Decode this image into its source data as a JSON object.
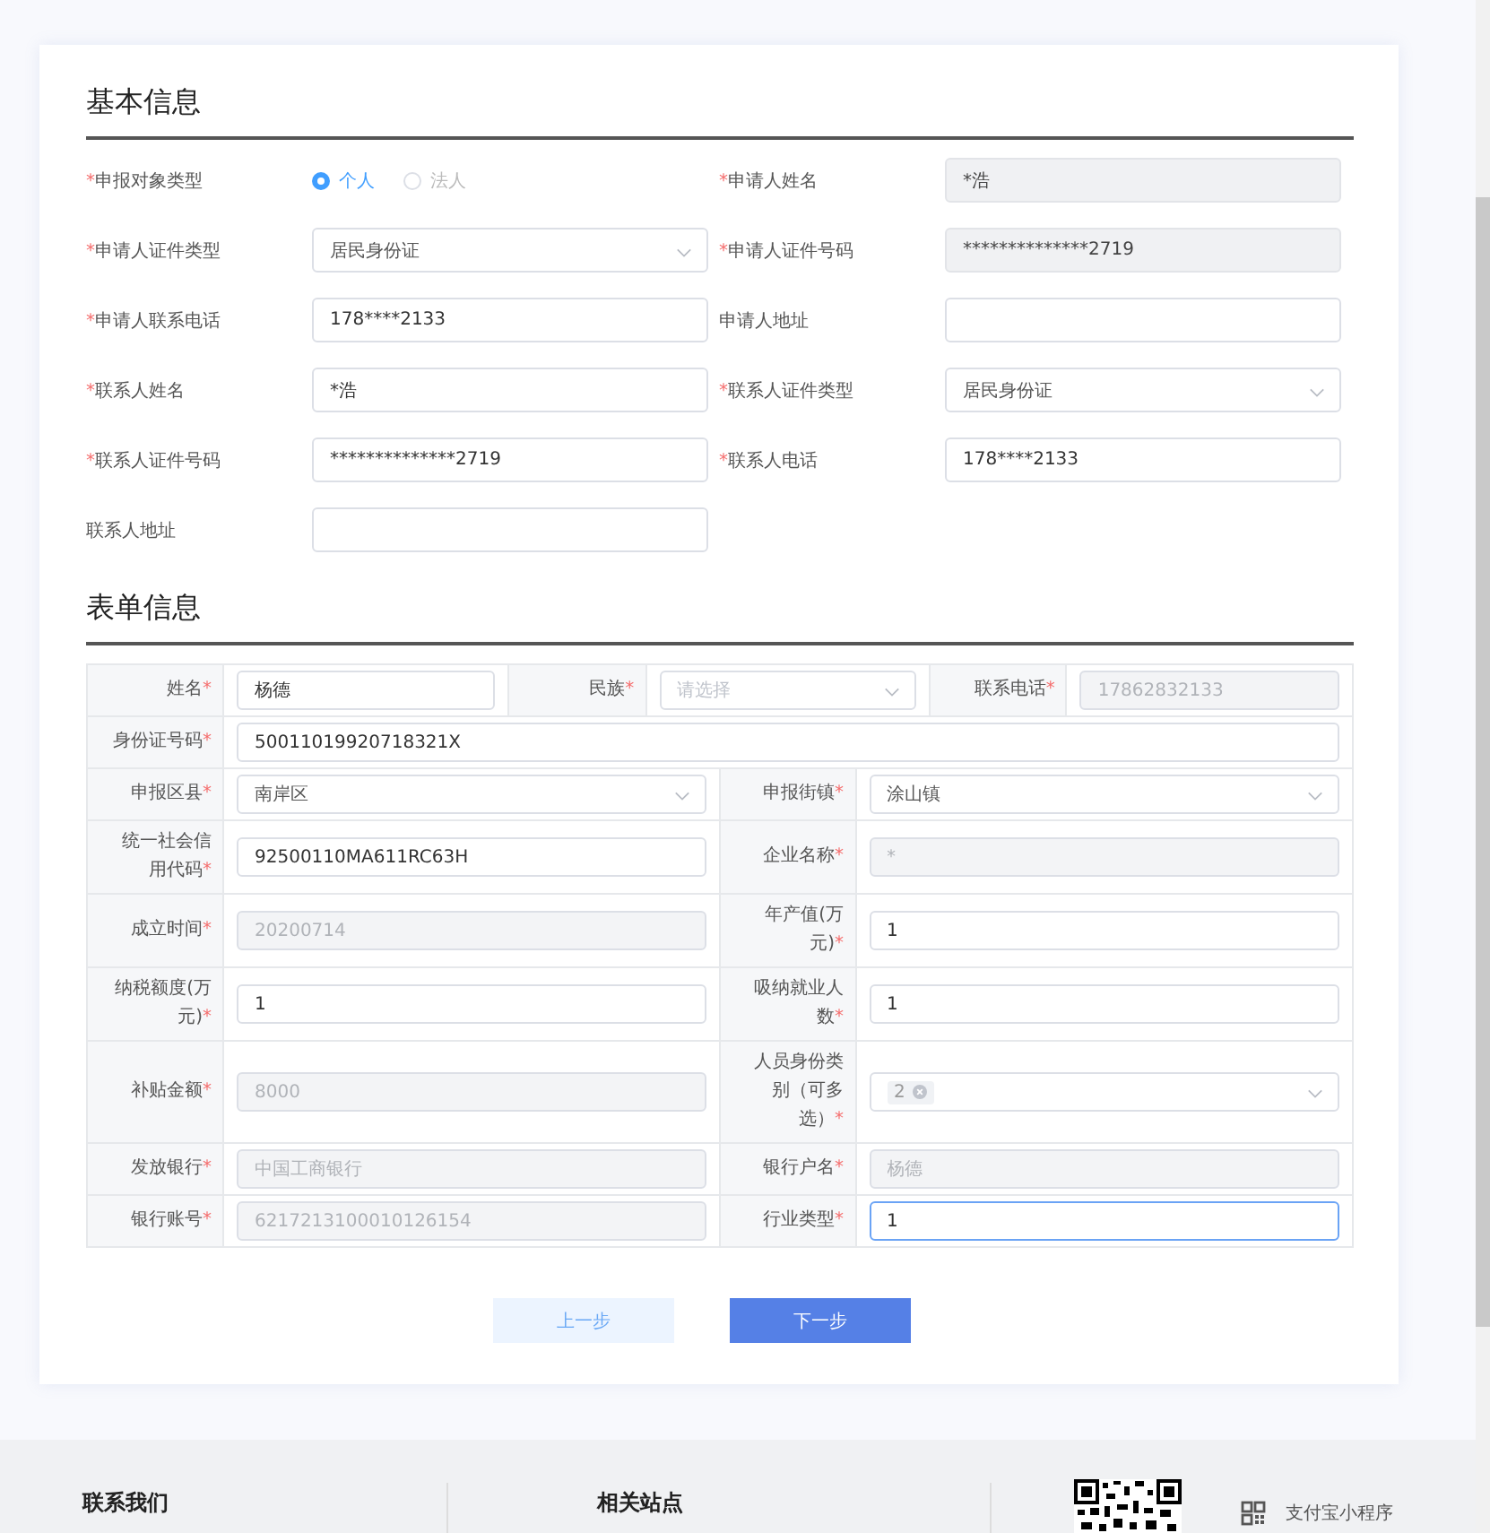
{
  "basic_info": {
    "title": "基本信息",
    "fields": [
      {
        "mark": "*",
        "label": "申报对象类型",
        "kind": "radio",
        "options": [
          {
            "label": "个人",
            "selected": true
          },
          {
            "label": "法人",
            "selected": false
          }
        ]
      },
      {
        "mark": "*",
        "label": "申请人姓名",
        "kind": "text",
        "value": "*浩",
        "disabled": true
      },
      {
        "mark": "*",
        "label": "申请人证件类型",
        "kind": "select",
        "value": "居民身份证",
        "disabled": false
      },
      {
        "mark": "*",
        "label": "申请人证件号码",
        "kind": "text",
        "value": "**************2719",
        "disabled": true
      },
      {
        "mark": "*",
        "label": "申请人联系电话",
        "kind": "text",
        "value": "178****2133",
        "disabled": false
      },
      {
        "label": "申请人地址",
        "kind": "text",
        "disabled": false
      },
      {
        "mark": "*",
        "label": "联系人姓名",
        "kind": "text",
        "value": "*浩",
        "disabled": false
      },
      {
        "mark": "*",
        "label": "联系人证件类型",
        "kind": "select",
        "value": "居民身份证",
        "disabled": false
      },
      {
        "mark": "*",
        "label": "联系人证件号码",
        "kind": "text",
        "value": "**************2719",
        "disabled": false
      },
      {
        "mark": "*",
        "label": "联系人电话",
        "kind": "text",
        "value": "178****2133",
        "disabled": false
      },
      {
        "label": "联系人地址",
        "kind": "text",
        "disabled": false
      }
    ]
  },
  "form_info": {
    "title": "表单信息",
    "rows": [
      {
        "cells": [
          {
            "label": "姓名",
            "mark": "*",
            "kind": "text",
            "value": "杨德",
            "disabled": false
          },
          {
            "label": "民族",
            "mark": "*",
            "kind": "select",
            "placeholder": "请选择",
            "disabled": false
          },
          {
            "label": "联系电话",
            "mark": "*",
            "kind": "text",
            "value": "17862832133",
            "disabled": true
          }
        ]
      },
      {
        "cells": [
          {
            "label": "身份证号码",
            "mark": "*",
            "kind": "text",
            "value": "50011019920718321X",
            "disabled": false
          }
        ]
      },
      {
        "cells": [
          {
            "label": "申报区县",
            "mark": "*",
            "kind": "select",
            "value": "南岸区",
            "disabled": false
          },
          {
            "label": "申报街镇",
            "mark": "*",
            "kind": "select",
            "value": "涂山镇",
            "disabled": false
          }
        ]
      },
      {
        "cells": [
          {
            "label": "统一社会信用代码",
            "mark": "*",
            "kind": "text",
            "value": "92500110MA611RC63H",
            "disabled": false
          },
          {
            "label": "企业名称",
            "mark": "*",
            "kind": "text",
            "value": "*",
            "disabled": true
          }
        ]
      },
      {
        "cells": [
          {
            "label": "成立时间",
            "mark": "*",
            "kind": "text",
            "value": "20200714",
            "disabled": true
          },
          {
            "label": "年产值(万元)",
            "mark": "*",
            "kind": "text",
            "value": "1",
            "disabled": false
          }
        ]
      },
      {
        "cells": [
          {
            "label": "纳税额度(万元)",
            "mark": "*",
            "kind": "text",
            "value": "1",
            "disabled": false
          },
          {
            "label": "吸纳就业人数",
            "mark": "*",
            "kind": "text",
            "value": "1",
            "disabled": false
          }
        ]
      },
      {
        "cells": [
          {
            "label": "补贴金额",
            "mark": "*",
            "kind": "text",
            "value": "8000",
            "disabled": true
          },
          {
            "label": "人员身份类别（可多选）",
            "mark": "*",
            "kind": "multiselect",
            "tags": [
              "2"
            ],
            "disabled": false
          }
        ]
      },
      {
        "cells": [
          {
            "label": "发放银行",
            "mark": "*",
            "kind": "text",
            "value": "中国工商银行",
            "disabled": true
          },
          {
            "label": "银行户名",
            "mark": "*",
            "kind": "text",
            "value": "杨德",
            "disabled": true
          }
        ]
      },
      {
        "cells": [
          {
            "label": "银行账号",
            "mark": "*",
            "kind": "text",
            "value": "6217213100010126154",
            "disabled": true
          },
          {
            "label": "行业类型",
            "mark": "*",
            "kind": "text",
            "value": "1",
            "disabled": false,
            "focused": true
          }
        ]
      }
    ]
  },
  "buttons": [
    {
      "label": "上一步",
      "kind": "secondary"
    },
    {
      "label": "下一步",
      "kind": "primary"
    }
  ],
  "footer": {
    "sections": [
      "联系我们",
      "相关站点"
    ],
    "mini_program": "支付宝小程序"
  }
}
